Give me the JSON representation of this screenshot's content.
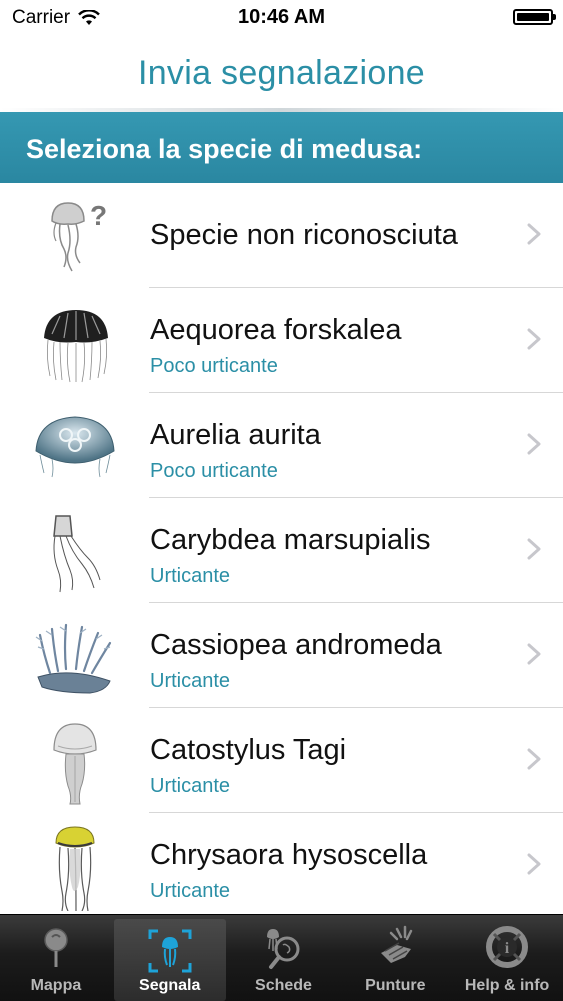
{
  "status": {
    "carrier": "Carrier",
    "time": "10:46 AM"
  },
  "header": {
    "title": "Invia segnalazione"
  },
  "section": {
    "title": "Seleziona la specie di medusa:"
  },
  "species": [
    {
      "name": "Specie non riconosciuta",
      "sting": "",
      "icon": "unknown-jellyfish-icon"
    },
    {
      "name": "Aequorea forskalea",
      "sting": "Poco urticante",
      "icon": "aequorea-jellyfish-icon"
    },
    {
      "name": "Aurelia aurita",
      "sting": "Poco urticante",
      "icon": "aurelia-jellyfish-icon"
    },
    {
      "name": "Carybdea marsupialis",
      "sting": "Urticante",
      "icon": "carybdea-jellyfish-icon"
    },
    {
      "name": "Cassiopea andromeda",
      "sting": "Urticante",
      "icon": "cassiopea-jellyfish-icon"
    },
    {
      "name": "Catostylus Tagi",
      "sting": "Urticante",
      "icon": "catostylus-jellyfish-icon"
    },
    {
      "name": "Chrysaora hysoscella",
      "sting": "Urticante",
      "icon": "chrysaora-jellyfish-icon"
    }
  ],
  "tabs": [
    {
      "label": "Mappa",
      "icon": "map-pin-icon"
    },
    {
      "label": "Segnala",
      "icon": "report-jellyfish-icon",
      "active": true
    },
    {
      "label": "Schede",
      "icon": "search-jellyfish-icon"
    },
    {
      "label": "Punture",
      "icon": "sting-hand-icon"
    },
    {
      "label": "Help & info",
      "icon": "lifebuoy-info-icon"
    }
  ],
  "colors": {
    "accent": "#2b8fa6",
    "section_bg": "#3096b0",
    "tabbar_bg": "#1c1c1c"
  }
}
